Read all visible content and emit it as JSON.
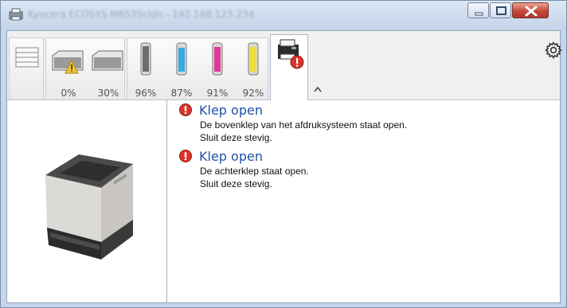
{
  "window": {
    "title": "Kyocera ECOSYS M6535cidn  -  192.168.123.234"
  },
  "toolbar": {
    "supplies": [
      {
        "name": "paper-cassette-1-icon",
        "percent": "0%"
      },
      {
        "name": "paper-cassette-2-icon",
        "percent": "30%"
      },
      {
        "name": "toner-black-icon",
        "percent": "96%",
        "color": "#7a7a7a"
      },
      {
        "name": "toner-cyan-icon",
        "percent": "87%",
        "color": "#37a9e0"
      },
      {
        "name": "toner-magenta-icon",
        "percent": "91%",
        "color": "#e0389a"
      },
      {
        "name": "toner-yellow-icon",
        "percent": "92%",
        "color": "#f0dc3a"
      }
    ]
  },
  "messages": [
    {
      "title": "Klep open",
      "line1": "De bovenklep van het afdruksysteem staat open.",
      "line2": "Sluit deze stevig."
    },
    {
      "title": "Klep open",
      "line1": "De achterklep staat open.",
      "line2": "Sluit deze stevig."
    }
  ],
  "colors": {
    "error": "#d9342b",
    "message_title": "#1f4fa8",
    "warning": "#f1c232"
  }
}
